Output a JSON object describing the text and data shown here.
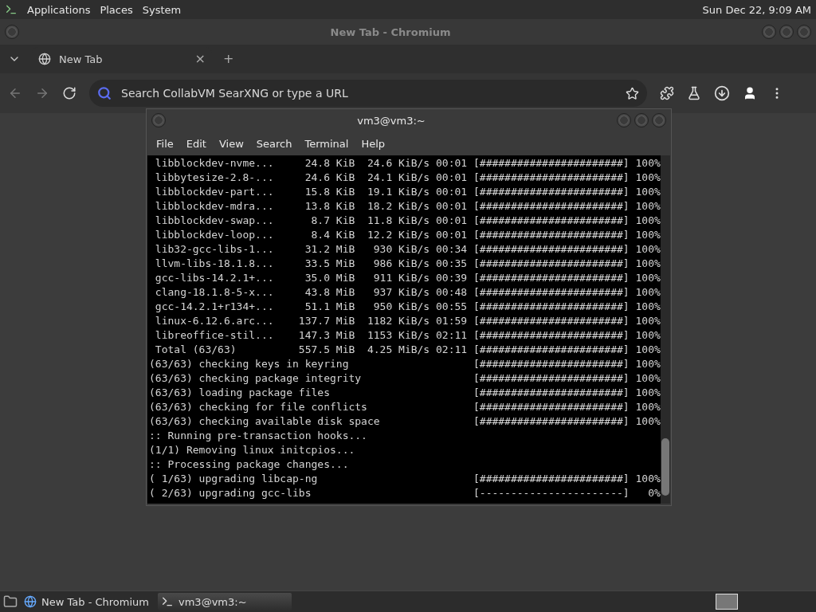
{
  "top_panel": {
    "menus": [
      "Applications",
      "Places",
      "System"
    ],
    "clock": "Sun Dec 22,  9:09 AM"
  },
  "browser": {
    "title": "New Tab - Chromium",
    "tabs": [
      {
        "label": "New Tab",
        "selected": true
      }
    ],
    "tab_close": "×",
    "new_tab": "+",
    "omnibox": {
      "placeholder": "Search CollabVM SearXNG or type a URL"
    }
  },
  "terminal": {
    "title": "vm3@vm3:~",
    "menu": [
      "File",
      "Edit",
      "View",
      "Search",
      "Terminal",
      "Help"
    ],
    "lines": [
      " libblockdev-nvme...     24.8 KiB  24.6 KiB/s 00:01 [#######################] 100%",
      " libbytesize-2.8-...     24.6 KiB  24.1 KiB/s 00:01 [#######################] 100%",
      " libblockdev-part...     15.8 KiB  19.1 KiB/s 00:01 [#######################] 100%",
      " libblockdev-mdra...     13.8 KiB  18.2 KiB/s 00:01 [#######################] 100%",
      " libblockdev-swap...      8.7 KiB  11.8 KiB/s 00:01 [#######################] 100%",
      " libblockdev-loop...      8.4 KiB  12.2 KiB/s 00:01 [#######################] 100%",
      " lib32-gcc-libs-1...     31.2 MiB   930 KiB/s 00:34 [#######################] 100%",
      " llvm-libs-18.1.8...     33.5 MiB   986 KiB/s 00:35 [#######################] 100%",
      " gcc-libs-14.2.1+...     35.0 MiB   911 KiB/s 00:39 [#######################] 100%",
      " clang-18.1.8-5-x...     43.8 MiB   937 KiB/s 00:48 [#######################] 100%",
      " gcc-14.2.1+r134+...     51.1 MiB   950 KiB/s 00:55 [#######################] 100%",
      " linux-6.12.6.arc...    137.7 MiB  1182 KiB/s 01:59 [#######################] 100%",
      " libreoffice-stil...    147.3 MiB  1153 KiB/s 02:11 [#######################] 100%",
      " Total (63/63)          557.5 MiB  4.25 MiB/s 02:11 [#######################] 100%",
      "(63/63) checking keys in keyring                    [#######################] 100%",
      "(63/63) checking package integrity                  [#######################] 100%",
      "(63/63) loading package files                       [#######################] 100%",
      "(63/63) checking for file conflicts                 [#######################] 100%",
      "(63/63) checking available disk space               [#######################] 100%",
      ":: Running pre-transaction hooks...",
      "(1/1) Removing linux initcpios...",
      ":: Processing package changes...",
      "( 1/63) upgrading libcap-ng                         [#######################] 100%",
      "( 2/63) upgrading gcc-libs                          [-----------------------]   0%"
    ]
  },
  "taskbar": {
    "items": [
      {
        "kind": "browser",
        "label": "New Tab - Chromium",
        "selected": false
      },
      {
        "kind": "terminal",
        "label": "vm3@vm3:~",
        "selected": true
      }
    ]
  }
}
